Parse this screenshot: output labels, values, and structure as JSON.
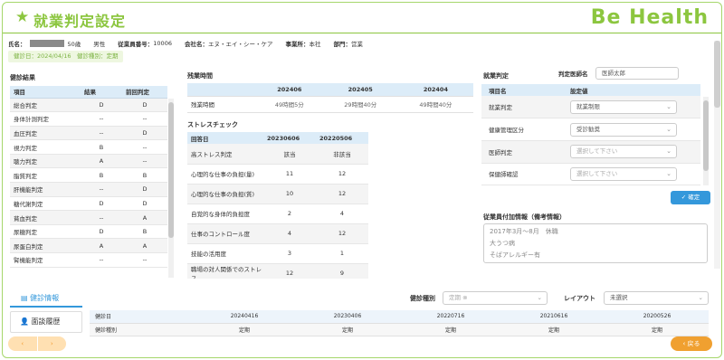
{
  "header": {
    "title": "就業判定設定",
    "logo": "Be Health"
  },
  "employee": {
    "name_label": "氏名：",
    "age": "50歳",
    "gender": "男性",
    "id_label": "従業員番号：",
    "id_value": "10006",
    "company_label": "会社名：",
    "company_value": "エヌ・エイ・シー・ケア",
    "office_label": "事業所：",
    "office_value": "本社",
    "dept_label": "部門：",
    "dept_value": "営業",
    "checkup_info": "健診日：2024/04/16　健診種別：定期"
  },
  "results": {
    "title": "健診結果",
    "columns": [
      "項目",
      "結果",
      "前回判定"
    ],
    "rows": [
      [
        "総合判定",
        "D",
        "D"
      ],
      [
        "身体計測判定",
        "--",
        "--"
      ],
      [
        "血圧判定",
        "--",
        "D"
      ],
      [
        "視力判定",
        "B",
        "--"
      ],
      [
        "聴力判定",
        "A",
        "--"
      ],
      [
        "脂質判定",
        "B",
        "B"
      ],
      [
        "肝機能判定",
        "--",
        "D"
      ],
      [
        "糖代謝判定",
        "D",
        "D"
      ],
      [
        "貧血判定",
        "--",
        "A"
      ],
      [
        "尿糖判定",
        "D",
        "B"
      ],
      [
        "尿蛋白判定",
        "A",
        "A"
      ],
      [
        "腎機能判定",
        "--",
        "--"
      ]
    ]
  },
  "overtime": {
    "title": "残業時間",
    "columns": [
      "",
      "202406",
      "202405",
      "202404"
    ],
    "row_label": "残業時間",
    "values": [
      "49時間5分",
      "29時間40分",
      "49時間40分"
    ]
  },
  "stress": {
    "title": "ストレスチェック",
    "columns": [
      "回答日",
      "20230606",
      "20220506"
    ],
    "rows": [
      [
        "高ストレス判定",
        "該当",
        "非該当"
      ],
      [
        "心理的な仕事の負担(量)",
        "11",
        "12"
      ],
      [
        "心理的な仕事の負担(質)",
        "10",
        "12"
      ],
      [
        "自覚的な身体的負担度",
        "2",
        "4"
      ],
      [
        "仕事のコントロール度",
        "4",
        "12"
      ],
      [
        "技能の活用度",
        "3",
        "1"
      ],
      [
        "職場の対人関係でのストレス",
        "12",
        "9"
      ]
    ]
  },
  "judgement": {
    "title": "就業判定",
    "doctor_label": "判定医師名",
    "doctor_value": "医師太郎",
    "columns": [
      "項目名",
      "設定値"
    ],
    "rows": [
      {
        "label": "就業判定",
        "value": "就業制限",
        "placeholder": false
      },
      {
        "label": "健康管理区分",
        "value": "受診勧奨",
        "placeholder": false
      },
      {
        "label": "医師判定",
        "value": "選択して下さい",
        "placeholder": true
      },
      {
        "label": "保健師確認",
        "value": "選択して下さい",
        "placeholder": true
      }
    ],
    "confirm_label": "✓ 確定"
  },
  "memo": {
    "title": "従業員付加情報（備考情報）",
    "lines": [
      "2017年3月～8月　休職",
      "大うつ病",
      "そばアレルギー有"
    ]
  },
  "tabs": {
    "checkup": "健診情報",
    "interview": "面談履歴"
  },
  "filters": {
    "type_label": "健診種別",
    "type_value": "定期",
    "layout_label": "レイアウト",
    "layout_value": "未選択"
  },
  "history": {
    "date_label": "健診日",
    "type_label": "健診種別",
    "dates": [
      "20240416",
      "20230406",
      "20220716",
      "20210616",
      "20200526"
    ],
    "types": [
      "定期",
      "定期",
      "定期",
      "定期",
      "定期"
    ]
  },
  "nav": {
    "prev": "‹",
    "next": "›",
    "back": "‹ 戻る"
  },
  "colors": {
    "brand": "#8cc63f",
    "accent": "#3498db",
    "back": "#f0a030"
  }
}
